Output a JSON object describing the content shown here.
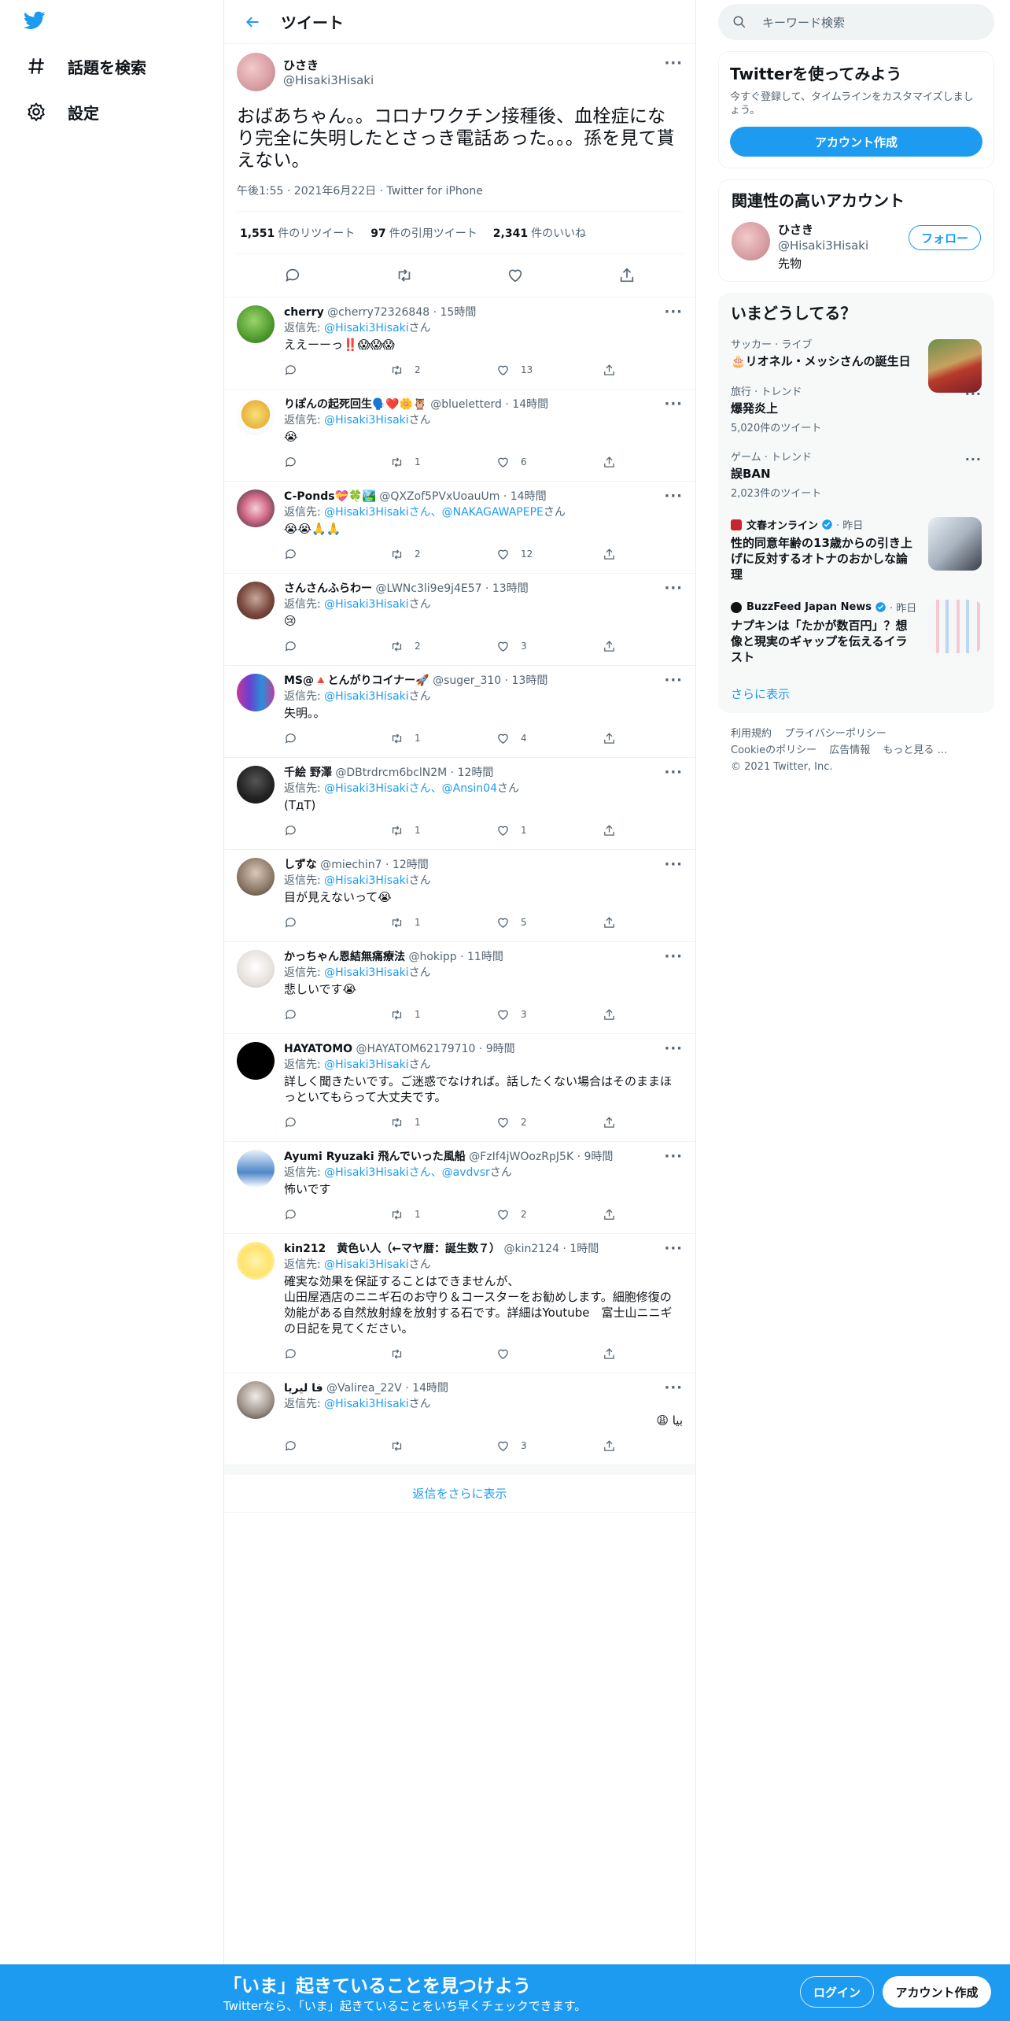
{
  "nav": {
    "explore_label": "話題を検索",
    "settings_label": "設定"
  },
  "header": {
    "title": "ツイート"
  },
  "main_tweet": {
    "name": "ひさき",
    "handle": "@Hisaki3Hisaki",
    "text": "おばあちゃん。。コロナワクチン接種後、血栓症になり完全に失明したとさっき電話あった。。。孫を見て貰えない。",
    "meta": "午後1:55 · 2021年6月22日 · Twitter for iPhone",
    "retweets_count": "1,551",
    "retweets_label": "件のリツイート",
    "quotes_count": "97",
    "quotes_label": "件の引用ツイート",
    "likes_count": "2,341",
    "likes_label": "件のいいね"
  },
  "replies": [
    {
      "name": "cherry",
      "handle": "@cherry72326848 · 15時間",
      "to_prefix": "返信先: ",
      "to_mention": "@Hisaki3Hisaki",
      "to_suffix": "さん",
      "text": "ええーーっ‼️😱😱😱",
      "retweets": "2",
      "likes": "13"
    },
    {
      "name": "りぽんの起死回生🗣️❤️🌼🦉",
      "handle": "@blueletterd · 14時間",
      "to_prefix": "返信先: ",
      "to_mention": "@Hisaki3Hisaki",
      "to_suffix": "さん",
      "text": "😭",
      "retweets": "1",
      "likes": "6"
    },
    {
      "name": "C-Ponds💝🍀🏞️",
      "handle": "@QXZof5PVxUoauUm · 14時間",
      "to_prefix": "返信先: ",
      "to_mention": "@Hisaki3Hisakiさん、@NAKAGAWAPEPE",
      "to_suffix": "さん",
      "text": "😭😭🙏🙏",
      "retweets": "2",
      "likes": "12"
    },
    {
      "name": "さんさんふらわー",
      "handle": "@LWNc3li9e9j4E57 · 13時間",
      "to_prefix": "返信先: ",
      "to_mention": "@Hisaki3Hisaki",
      "to_suffix": "さん",
      "text": "😢",
      "retweets": "2",
      "likes": "3"
    },
    {
      "name": "MS@🔺とんがりコイナー🚀",
      "handle": "@suger_310 · 13時間",
      "to_prefix": "返信先: ",
      "to_mention": "@Hisaki3Hisaki",
      "to_suffix": "さん",
      "text": "失明。。",
      "retweets": "1",
      "likes": "4"
    },
    {
      "name": "千絵 野澤",
      "handle": "@DBtrdrcm6bclN2M · 12時間",
      "to_prefix": "返信先: ",
      "to_mention": "@Hisaki3Hisakiさん、@Ansin04",
      "to_suffix": "さん",
      "text": "(TдT)",
      "retweets": "1",
      "likes": "1"
    },
    {
      "name": "しずな",
      "handle": "@miechin7 · 12時間",
      "to_prefix": "返信先: ",
      "to_mention": "@Hisaki3Hisaki",
      "to_suffix": "さん",
      "text": "目が見えないって😭",
      "retweets": "1",
      "likes": "5"
    },
    {
      "name": "かっちゃん恩結無痛療法",
      "handle": "@hokipp · 11時間",
      "to_prefix": "返信先: ",
      "to_mention": "@Hisaki3Hisaki",
      "to_suffix": "さん",
      "text": "悲しいです😭",
      "retweets": "1",
      "likes": "3"
    },
    {
      "name": "HAYATOMO",
      "handle": "@HAYATOM62179710 · 9時間",
      "to_prefix": "返信先: ",
      "to_mention": "@Hisaki3Hisaki",
      "to_suffix": "さん",
      "text": "詳しく聞きたいです。ご迷惑でなければ。話したくない場合はそのままほっといてもらって大丈夫です。",
      "retweets": "1",
      "likes": "2"
    },
    {
      "name": "Ayumi Ryuzaki 飛んでいった風船",
      "handle": "@FzIf4jWOozRpJ5K · 9時間",
      "to_prefix": "返信先: ",
      "to_mention": "@Hisaki3Hisakiさん、@avdvsr",
      "to_suffix": "さん",
      "text": "怖いです",
      "retweets": "1",
      "likes": "2"
    },
    {
      "name": "kin212　黄色い人（←マヤ暦：誕生数７）",
      "handle": "@kin2124 · 1時間",
      "to_prefix": "返信先: ",
      "to_mention": "@Hisaki3Hisaki",
      "to_suffix": "さん",
      "text": "確実な効果を保証することはできませんが、\n山田屋酒店のニニギ石のお守り＆コースターをお勧めします。細胞修復の効能がある自然放射線を放射する石です。詳細はYoutube　富士山ニニギの日記を見てください。",
      "retweets": "",
      "likes": ""
    },
    {
      "name": "فا ليريا",
      "handle": "@Valirea_22V · 14時間",
      "to_prefix": "返信先: ",
      "to_mention": "@Hisaki3Hisaki",
      "to_suffix": "さん",
      "text": "بيا 😩",
      "retweets": "",
      "likes": "3"
    }
  ],
  "show_more_replies": "返信をさらに表示",
  "search": {
    "placeholder": "キーワード検索"
  },
  "signup_card": {
    "title": "Twitterを使ってみよう",
    "desc": "今すぐ登録して、タイムラインをカスタマイズしましょう。",
    "button": "アカウント作成"
  },
  "related": {
    "title": "関連性の高いアカウント",
    "name": "ひさき",
    "handle": "@Hisaki3Hisaki",
    "bio": "先物",
    "follow": "フォロー"
  },
  "trends": {
    "title": "いまどうしてる？",
    "items": [
      {
        "meta": "サッカー · ライブ",
        "name": "🎂リオネル・メッシさんの誕生日",
        "count": ""
      },
      {
        "meta": "旅行 · トレンド",
        "name": "爆発炎上",
        "count": "5,020件のツイート"
      },
      {
        "meta": "ゲーム · トレンド",
        "name": "誤BAN",
        "count": "2,023件のツイート"
      }
    ],
    "news": [
      {
        "source": "文春オンライン",
        "time": "· 昨日",
        "title": "性的同意年齢の13歳からの引き上げに反対するオトナのおかしな論理"
      },
      {
        "source": "BuzzFeed Japan News",
        "time": "· 昨日",
        "title": "ナプキンは「たかが数百円」？想像と現実のギャップを伝えるイラスト"
      }
    ],
    "show_more": "さらに表示"
  },
  "footer": {
    "links": [
      "利用規約",
      "プライバシーポリシー",
      "Cookieのポリシー",
      "広告情報",
      "もっと見る …"
    ],
    "copyright": "© 2021 Twitter, Inc."
  },
  "bottom_bar": {
    "title": "「いま」起きていることを見つけよう",
    "subtitle": "Twitterなら、「いま」起きていることをいち早くチェックできます。",
    "login": "ログイン",
    "signup": "アカウント作成"
  },
  "colors": {
    "accent": "#1d9bf0",
    "text": "#0f1419",
    "muted": "#536471"
  }
}
